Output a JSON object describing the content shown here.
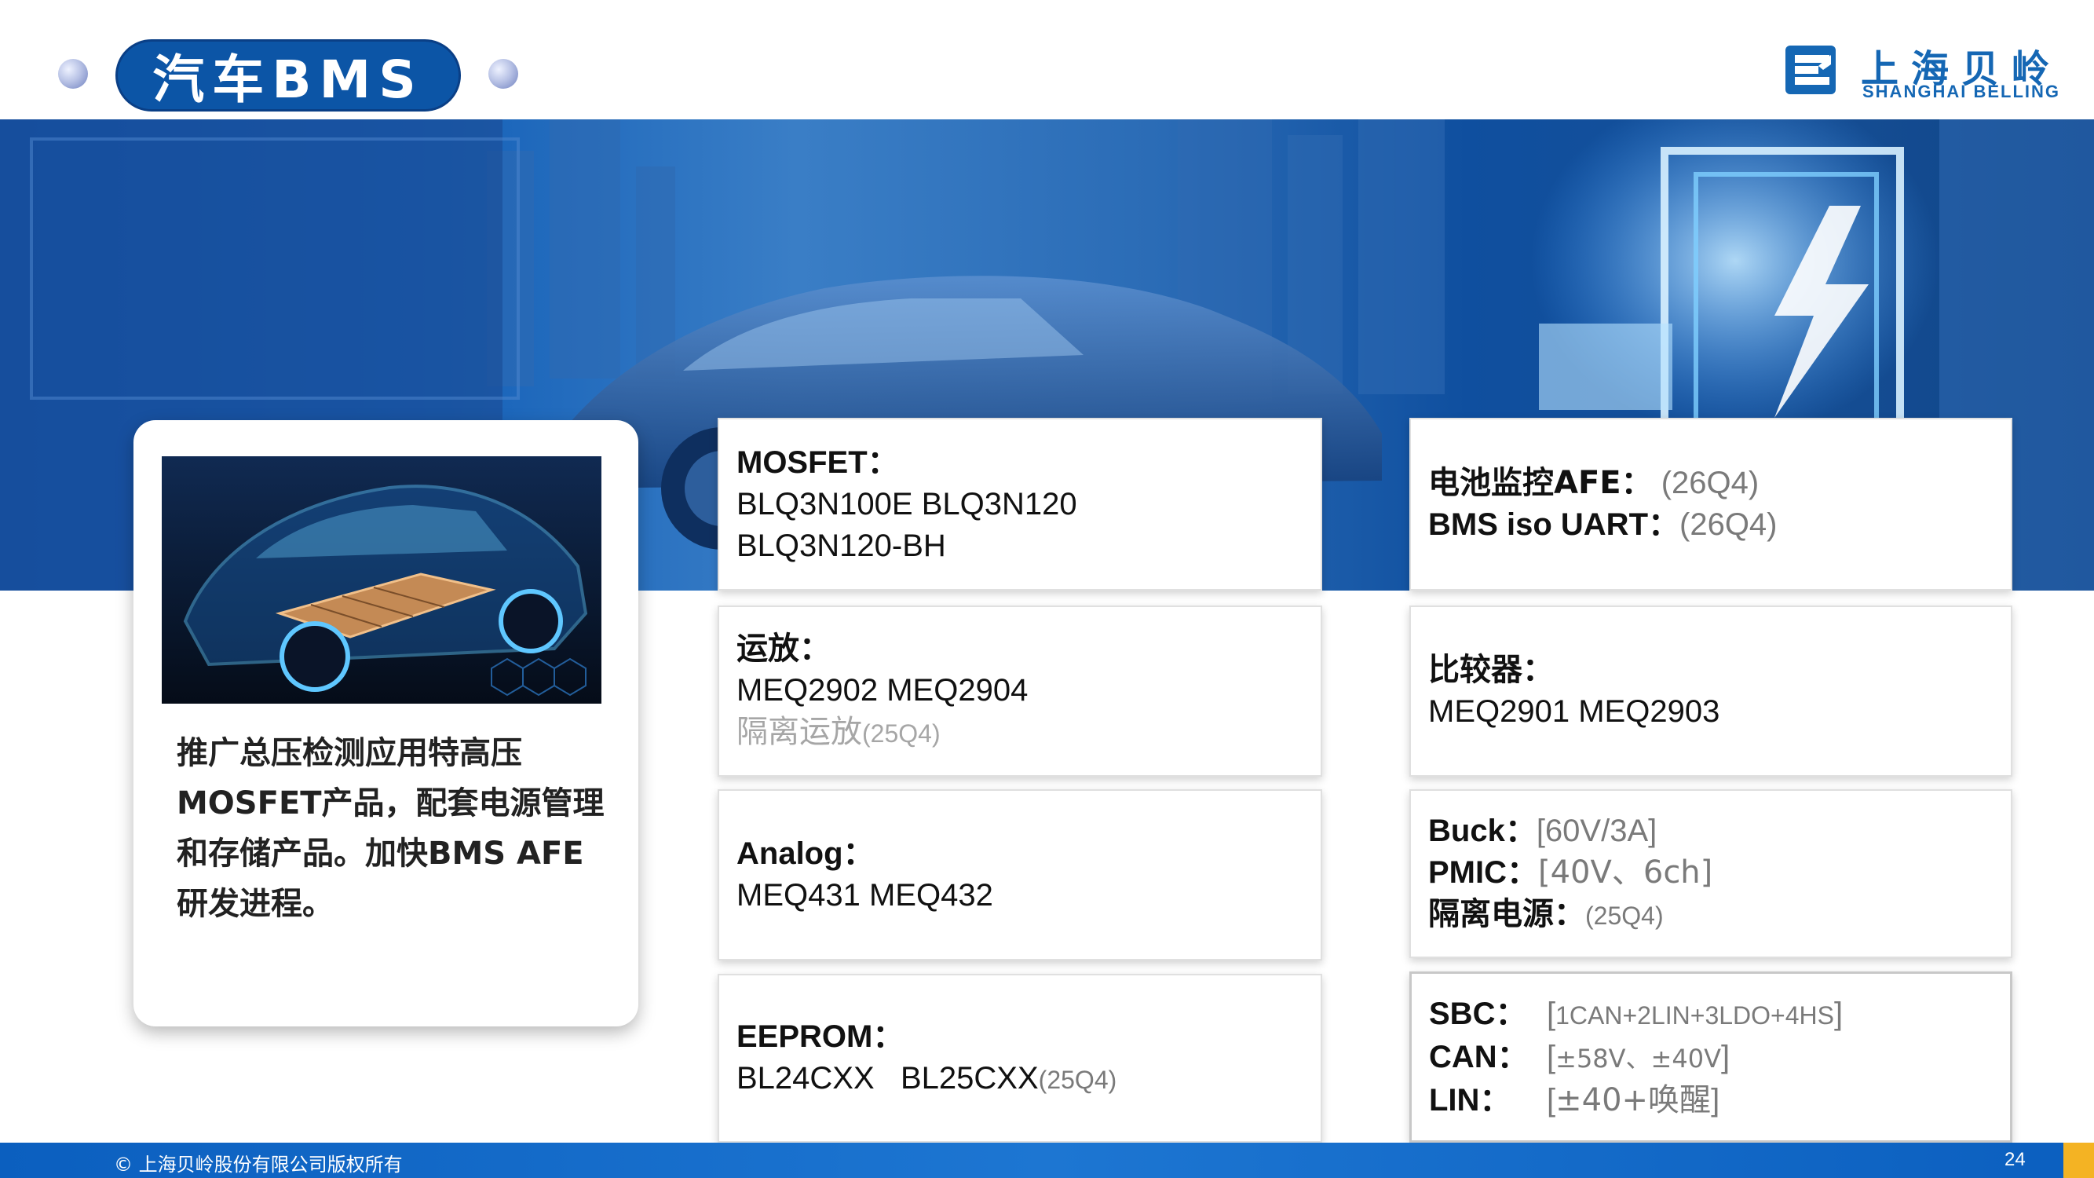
{
  "header": {
    "title": "汽车BMS",
    "logo": {
      "name_cn": "上海贝岭",
      "name_en": "SHANGHAI BELLING",
      "icon": "belling-logo-icon"
    }
  },
  "banner": {
    "image": "electric-car-city-background"
  },
  "left_card": {
    "image": "ev-battery-chassis-illustration",
    "text": "推广总压检测应用特高压MOSFET产品，配套电源管理和存储产品。加快BMS AFE研发进程。"
  },
  "products": {
    "mosfet": {
      "label": "MOSFET：",
      "line1": "BLQ3N100E  BLQ3N120",
      "line2": "BLQ3N120-BH"
    },
    "afe": {
      "label1": "电池监控AFE：",
      "value1": " (26Q4)",
      "label2": "BMS iso UART：",
      "value2": "(26Q4)"
    },
    "opamp": {
      "label": "运放：",
      "line1": "MEQ2902 MEQ2904",
      "isolated": "隔离运放",
      "isolated_date": "(25Q4)"
    },
    "comparator": {
      "label": "比较器：",
      "line1": "MEQ2901 MEQ2903"
    },
    "analog": {
      "label": "Analog：",
      "line1": "MEQ431  MEQ432"
    },
    "power": {
      "buck_label": "Buck：",
      "buck_value": "[60V/3A]",
      "pmic_label": "PMIC：",
      "pmic_value": "[40V、6ch]",
      "iso_label": "隔离电源：",
      "iso_value": "(25Q4)"
    },
    "eeprom": {
      "label": "EEPROM：",
      "line1": "BL24CXX   BL25CXX",
      "date": "(25Q4)"
    },
    "interface": {
      "sbc_label": "SBC：",
      "sbc_open": "[",
      "sbc_value": "1CAN+2LIN+3LDO+4HS",
      "sbc_close": "]",
      "can_label": "CAN：",
      "can_open": "[",
      "can_value": "±58V、±40V",
      "can_close": "]",
      "lin_label": "LIN：",
      "lin_open": "[",
      "lin_value": "±40+唤醒",
      "lin_close": "]"
    }
  },
  "footer": {
    "copyright": "© 上海贝岭股份有限公司版权所有",
    "page": "24"
  },
  "colors": {
    "brand_blue": "#0c55a6",
    "logo_blue": "#1567b4",
    "footer_blue": "#1d76d2",
    "accent_yellow": "#f4b323"
  }
}
